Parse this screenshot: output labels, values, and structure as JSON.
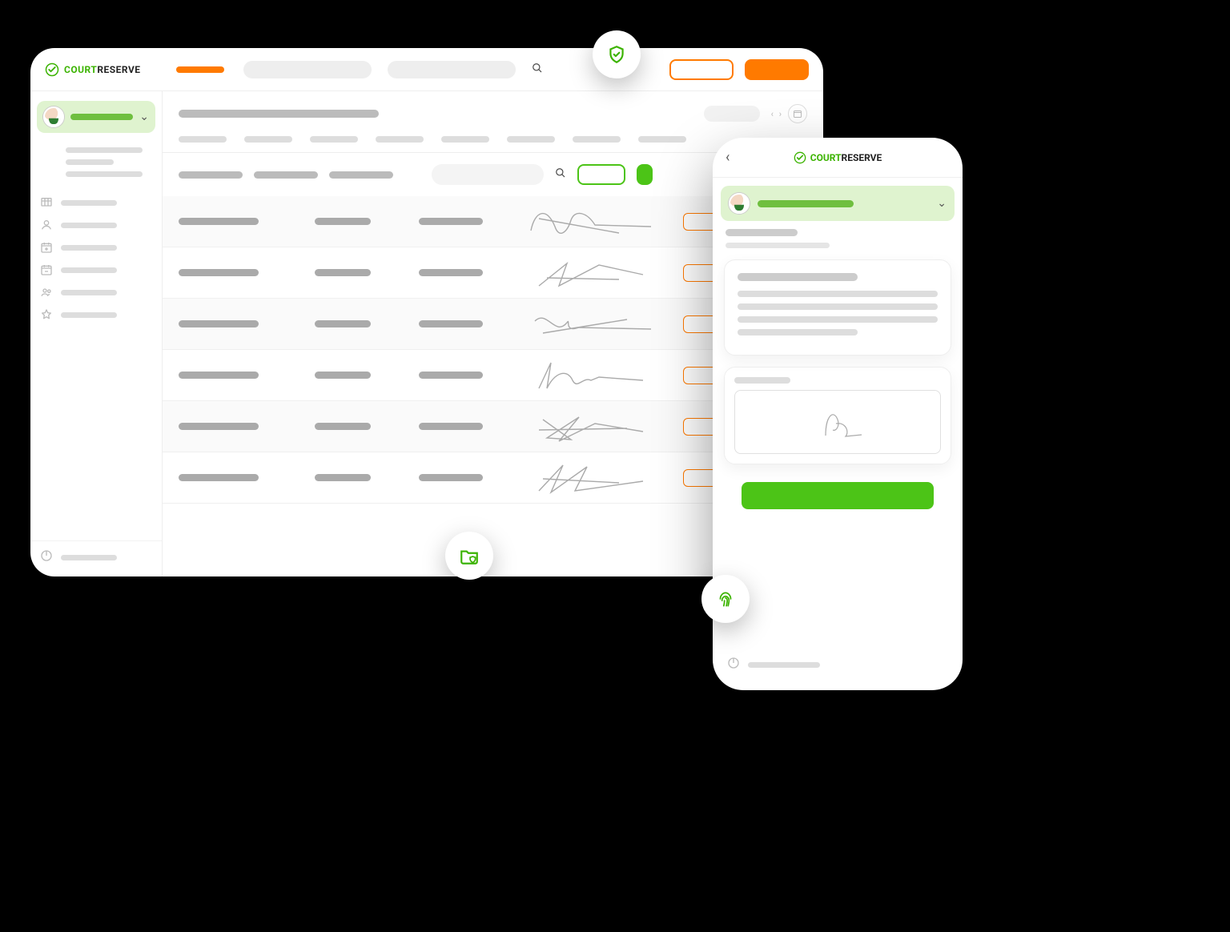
{
  "brand": {
    "part_a": "COURT",
    "part_b": "RESERVE"
  },
  "desktop": {
    "topbar": {
      "active_tab": "",
      "search1_placeholder": "",
      "search2_placeholder": "",
      "outline_btn_label": "",
      "primary_btn_label": ""
    },
    "sidebar": {
      "user_name": "",
      "sublinks": [
        "",
        "",
        ""
      ],
      "items": [
        {
          "icon": "grid",
          "label": ""
        },
        {
          "icon": "user",
          "label": ""
        },
        {
          "icon": "calendar-add",
          "label": ""
        },
        {
          "icon": "calendar-minus",
          "label": ""
        },
        {
          "icon": "group",
          "label": ""
        },
        {
          "icon": "star",
          "label": ""
        }
      ],
      "power_label": ""
    },
    "page_title": "",
    "period_label": "",
    "column_headers": [
      "",
      "",
      "",
      "",
      "",
      "",
      "",
      ""
    ],
    "filters": {
      "f1": "",
      "f2": "",
      "f3": "",
      "search_placeholder": "",
      "outline_btn": "",
      "solid_btn": ""
    },
    "rows": [
      {
        "c1": "",
        "c2": "",
        "c3": "",
        "action": ""
      },
      {
        "c1": "",
        "c2": "",
        "c3": "",
        "action": ""
      },
      {
        "c1": "",
        "c2": "",
        "c3": "",
        "action": ""
      },
      {
        "c1": "",
        "c2": "",
        "c3": "",
        "action": ""
      },
      {
        "c1": "",
        "c2": "",
        "c3": "",
        "action": ""
      },
      {
        "c1": "",
        "c2": "",
        "c3": "",
        "action": ""
      }
    ]
  },
  "mobile": {
    "user_name": "",
    "subtitle": "",
    "subtitle2": "",
    "card1_heading": "",
    "card1_body": [
      "",
      "",
      "",
      ""
    ],
    "sign_label": "",
    "cta_label": "",
    "power_label": ""
  },
  "badges": {
    "shield": "shield-check",
    "folder": "folder-shield",
    "fingerprint": "fingerprint"
  },
  "colors": {
    "brand_green": "#3bb300",
    "action_green": "#4cc417",
    "orange": "#ff7a00"
  }
}
